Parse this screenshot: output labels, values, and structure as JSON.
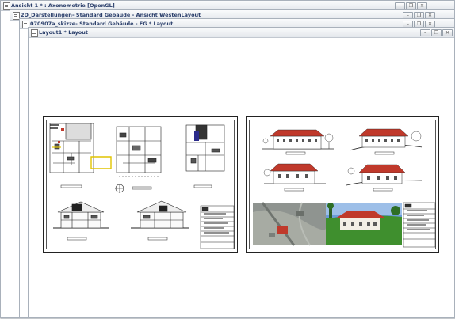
{
  "windows": [
    {
      "title": "Ansicht 1 * : Axonometrie [OpenGL]"
    },
    {
      "title": "2D_Darstellungen- Standard Gebäude - Ansicht WestenLayout"
    },
    {
      "title": "070907a_skizze- Standard Gebäude - EG * Layout"
    },
    {
      "title": "Layout1 * Layout"
    }
  ],
  "controls": {
    "minimize": "–",
    "restore": "❐",
    "close": "✕"
  },
  "colors": {
    "title_text": "#2b3f6b",
    "roof_red": "#c0392b",
    "lawn_green": "#3f8f2e",
    "sky_blue": "#6a9bd8"
  }
}
